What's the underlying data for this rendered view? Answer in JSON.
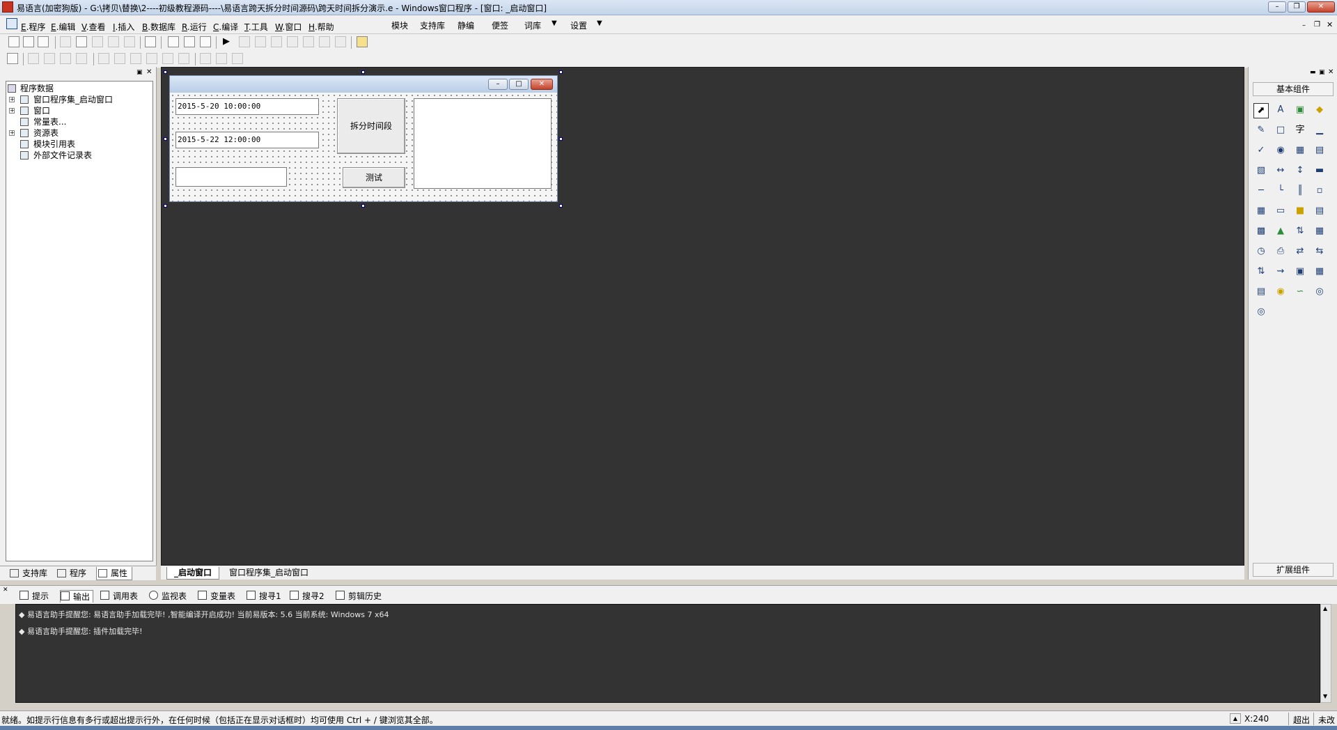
{
  "titlebar": {
    "title": "易语言(加密狗版) - G:\\拷贝\\替换\\2----初级教程源码----\\易语言跨天拆分时间源码\\跨天时间拆分演示.e - Windows窗口程序 - [窗口: _启动窗口]"
  },
  "menu": {
    "items": [
      {
        "key": "E",
        "label": ".程序"
      },
      {
        "key": "E",
        "label": ".编辑"
      },
      {
        "key": "V",
        "label": ".查看"
      },
      {
        "key": "I",
        "label": ".插入"
      },
      {
        "key": "B",
        "label": ".数据库"
      },
      {
        "key": "R",
        "label": ".运行"
      },
      {
        "key": "C",
        "label": ".编译"
      },
      {
        "key": "T",
        "label": ".工具"
      },
      {
        "key": "W",
        "label": ".窗口"
      },
      {
        "key": "H",
        "label": ".帮助"
      }
    ],
    "extras": [
      "模块",
      "支持库",
      "静编",
      "便签",
      "词库",
      "设置"
    ]
  },
  "tree": {
    "root": "程序数据",
    "items": [
      "窗口程序集_启动窗口",
      "窗口",
      "常量表...",
      "资源表",
      "模块引用表",
      "外部文件记录表"
    ]
  },
  "left_tabs": [
    "支持库",
    "程序",
    "属性"
  ],
  "designer": {
    "start_time": "2015-5-20 10:00:00",
    "end_time": "2015-5-22 12:00:00",
    "split_button": "拆分时间段",
    "test_button": "测试"
  },
  "doc_tabs": [
    "_启动窗口",
    "窗口程序集_启动窗口"
  ],
  "right_panel": {
    "basic_header": "基本组件",
    "ext_header": "扩展组件"
  },
  "bottom_tabs": [
    "提示",
    "输出",
    "调用表",
    "监视表",
    "变量表",
    "搜寻1",
    "搜寻2",
    "剪辑历史"
  ],
  "output": {
    "lines": [
      "易语言助手提醒您: 易语言助手加载完毕! ,智能编译开启成功! 当前易版本: 5.6 当前系统: Windows 7 x64",
      "易语言助手提醒您: 插件加载完毕!"
    ]
  },
  "status": {
    "message": "就绪。如提示行信息有多行或超出提示行外，在任何时候（包括正在显示对话框时）均可使用 Ctrl + / 键浏览其全部。",
    "coord": "X:240",
    "mode": "超出",
    "modified": "未改"
  }
}
